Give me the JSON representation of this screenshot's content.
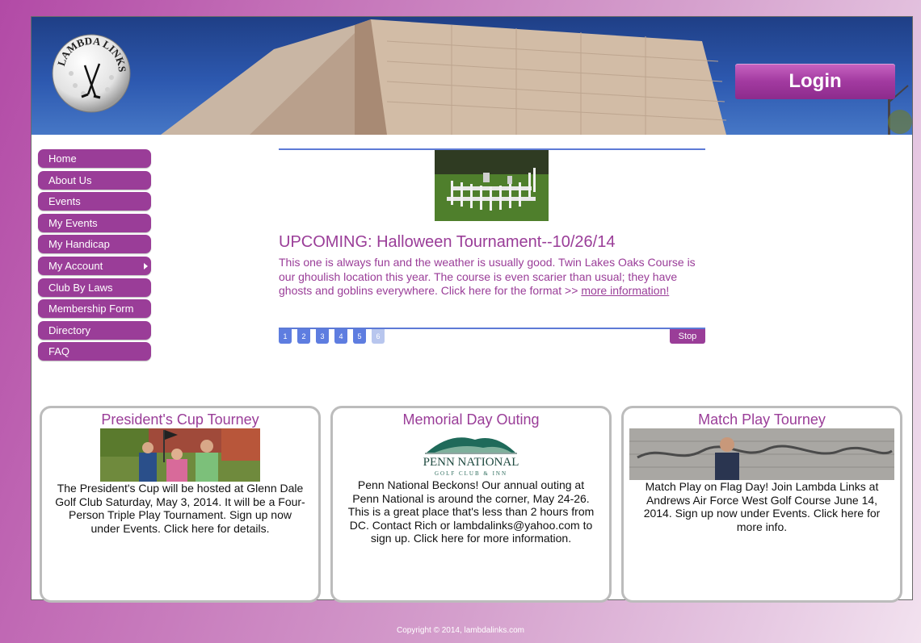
{
  "header": {
    "logo_text": "LAMBDA LINKS",
    "login_label": "Login"
  },
  "nav": {
    "items": [
      {
        "label": "Home"
      },
      {
        "label": "About Us"
      },
      {
        "label": "Events"
      },
      {
        "label": "My Events"
      },
      {
        "label": "My Handicap"
      },
      {
        "label": "My Account",
        "has_submenu": true
      },
      {
        "label": "Club By Laws"
      },
      {
        "label": "Membership Form"
      },
      {
        "label": "Directory"
      },
      {
        "label": "FAQ"
      }
    ]
  },
  "slider": {
    "title": "UPCOMING: Halloween Tournament--10/26/14",
    "text": "This one is always fun and the weather is usually good. Twin Lakes Oaks Course is our ghoulish location this year. The course is even scarier than usual; they have ghosts and goblins everywhere. Click here for the format >> ",
    "link": "more information!",
    "pages": [
      "1",
      "2",
      "3",
      "4",
      "5",
      "6"
    ],
    "active_page": "6",
    "stop_label": "Stop"
  },
  "cards": [
    {
      "title": "President's Cup Tourney",
      "text": "The President's Cup will be hosted at Glenn Dale Golf Club Saturday, May 3, 2014. It will be a Four-Person Triple Play Tournament. Sign up now under Events. Click here for details."
    },
    {
      "title": "Memorial Day Outing",
      "logo_main": "PENN NATIONAL",
      "logo_sub": "GOLF CLUB & INN",
      "text": "Penn National Beckons! Our annual outing at Penn National is around the corner, May 24-26. This is a great place that's less than 2 hours from DC. Contact Rich or lambdalinks@yahoo.com to sign up. Click here for more information."
    },
    {
      "title": "Match Play Tourney",
      "text": "Match Play on Flag Day! Join Lambda Links at Andrews Air Force West Golf Course June 14, 2014. Sign up now under Events. Click here for more info."
    }
  ],
  "footer": {
    "copyright": "Copyright © 2014, lambdalinks.com"
  },
  "colors": {
    "brand_purple": "#9a3d98",
    "pager_blue": "#5e7de0",
    "rule_blue": "#5d7ad6"
  }
}
